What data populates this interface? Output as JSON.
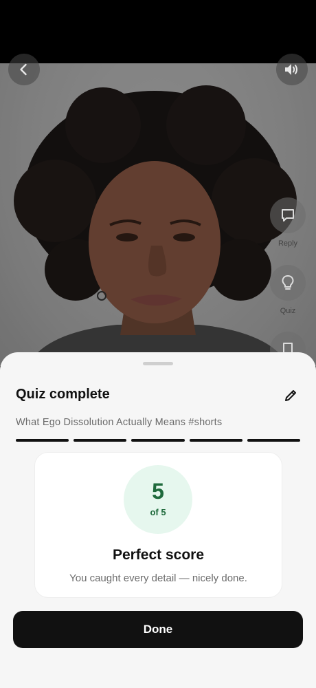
{
  "video": {
    "icons": {
      "back": "chevron-left-icon",
      "sound": "speaker-icon",
      "reply": "speech-bubble-icon",
      "quiz": "lightbulb-icon",
      "third": "bookmark-icon"
    },
    "side_actions": [
      {
        "label": "Reply"
      },
      {
        "label": "Quiz"
      }
    ]
  },
  "sheet": {
    "title": "Quiz complete",
    "video_title": "What Ego Dissolution Actually Means #shorts",
    "progress_segments": 5,
    "progress_completed": 5,
    "score": {
      "value": "5",
      "of_label": "of 5"
    },
    "result_title": "Perfect score",
    "result_message": "You caught every detail — nicely done.",
    "done_label": "Done"
  },
  "colors": {
    "accent_green": "#1f6a3c",
    "score_bg": "#e6f7ee",
    "primary_button": "#111111",
    "sheet_bg": "#f6f6f6"
  }
}
